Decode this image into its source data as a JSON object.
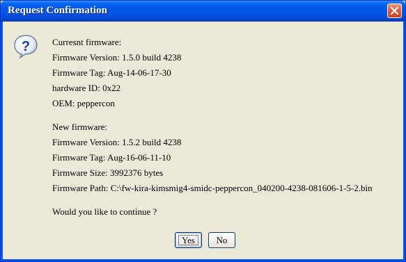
{
  "window": {
    "title": "Request Confirmation",
    "close_icon": "close-icon"
  },
  "icon": {
    "name": "question-icon",
    "glyph": "?"
  },
  "message": {
    "lines": [
      "Curresnt firmware:",
      "Firmware Version: 1.5.0  build 4238",
      "Firmware Tag: Aug-14-06-17-30",
      "hardware ID: 0x22",
      "OEM: peppercon",
      "",
      "New firmware:",
      "Firmware Version: 1.5.2  build 4238",
      "Firmware Tag: Aug-16-06-11-10",
      "Firmware Size: 3992376 bytes",
      "Firmware Path: C:\\fw-kira-kimsmig4-smidc-peppercon_040200-4238-081606-1-5-2.bin",
      "",
      "Would you like to continue ?"
    ]
  },
  "buttons": {
    "yes_label": "Yes",
    "no_label": "No"
  },
  "colors": {
    "titlebar": "#0055e5",
    "dialog_bg": "#ece9d8",
    "close_button": "#e0603e"
  }
}
